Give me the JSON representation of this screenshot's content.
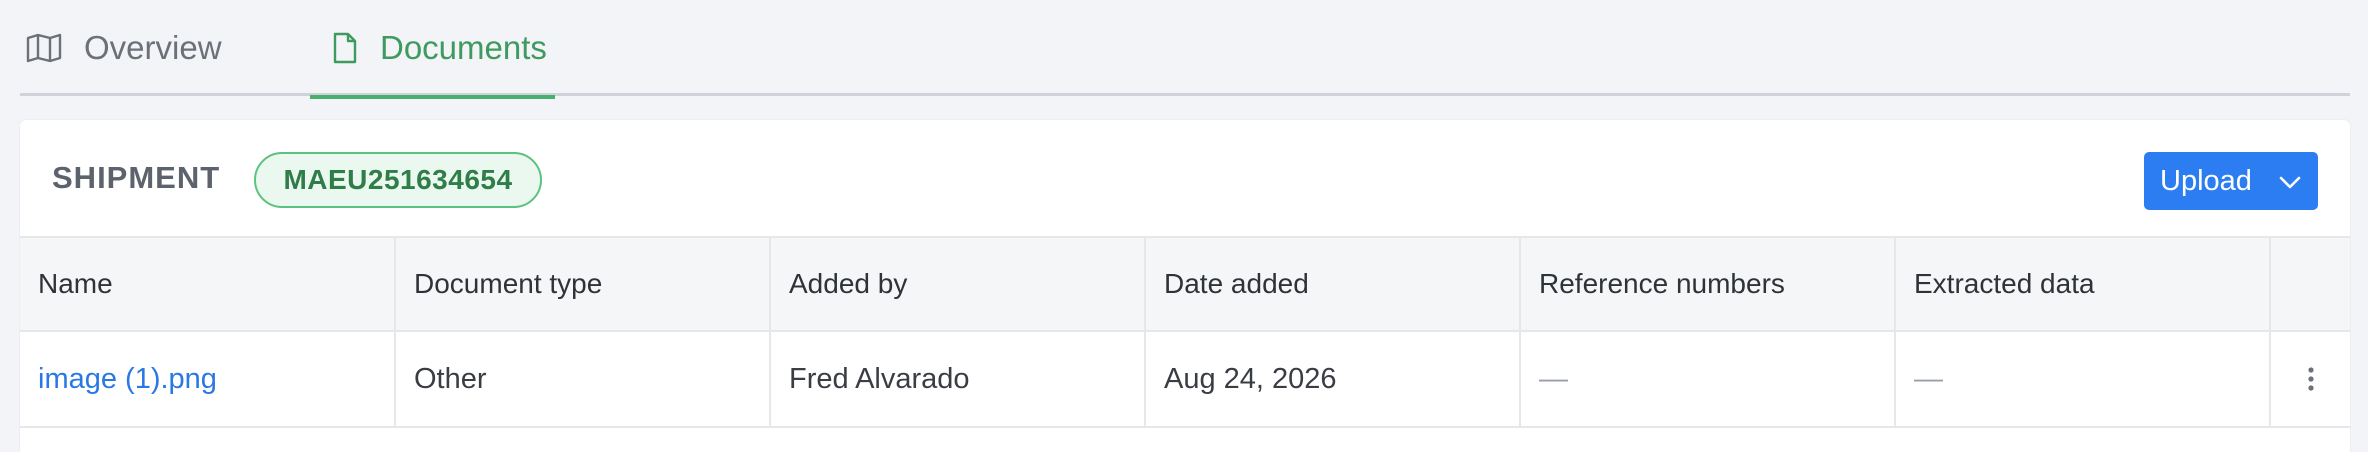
{
  "tabs": [
    {
      "label": "Overview",
      "icon": "map-icon",
      "active": false
    },
    {
      "label": "Documents",
      "icon": "document-icon",
      "active": true
    }
  ],
  "shipment": {
    "label": "SHIPMENT",
    "id": "MAEU251634654"
  },
  "upload_button": {
    "label": "Upload",
    "icon": "chevron-down-icon"
  },
  "table": {
    "columns": [
      "Name",
      "Document type",
      "Added by",
      "Date added",
      "Reference numbers",
      "Extracted data"
    ],
    "rows": [
      {
        "name": "image (1).png",
        "document_type": "Other",
        "added_by": "Fred Alvarado",
        "date_added": "Aug 24, 2026",
        "reference_numbers": "—",
        "extracted_data": "—"
      }
    ]
  },
  "colors": {
    "accent_green": "#48b06f",
    "primary_blue": "#2d7df2",
    "link_blue": "#2a78e4"
  }
}
